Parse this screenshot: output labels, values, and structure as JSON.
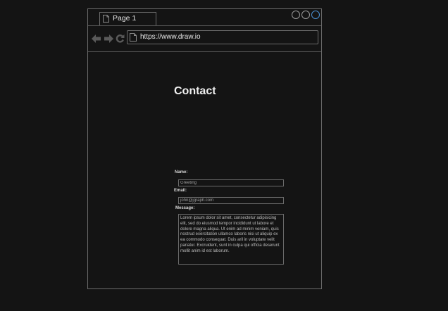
{
  "browser": {
    "tab_label": "Page 1",
    "url": "https://www.draw.io"
  },
  "page": {
    "title": "Contact"
  },
  "form": {
    "name_label": "Name:",
    "name_value": "Greeting",
    "email_label": "Email:",
    "email_value": "john@jgraph.com",
    "message_label": "Message:",
    "message_value": "Lorem ipsum dolor sit amet, consectetur adipisicing elit, sed do eiusmod tempor incididunt ut labore et dolore magna aliqua. Ut enim ad minim veniam, quis nostrud exercitation ullamco laboris nisi ut aliquip ex ea commodo consequat. Duis aril in voluptate velit pariatur. Excruident, sunt in culpa qui officia deserunt mollit anim id est laborum."
  },
  "icons": {
    "back": "arrow-left-icon",
    "forward": "arrow-right-icon",
    "reload": "reload-icon",
    "document": "document-icon"
  },
  "colors": {
    "background": "#141414",
    "border": "#6c6c6c",
    "text": "#e6e6e6",
    "maximize_accent": "#4a8fd1"
  }
}
